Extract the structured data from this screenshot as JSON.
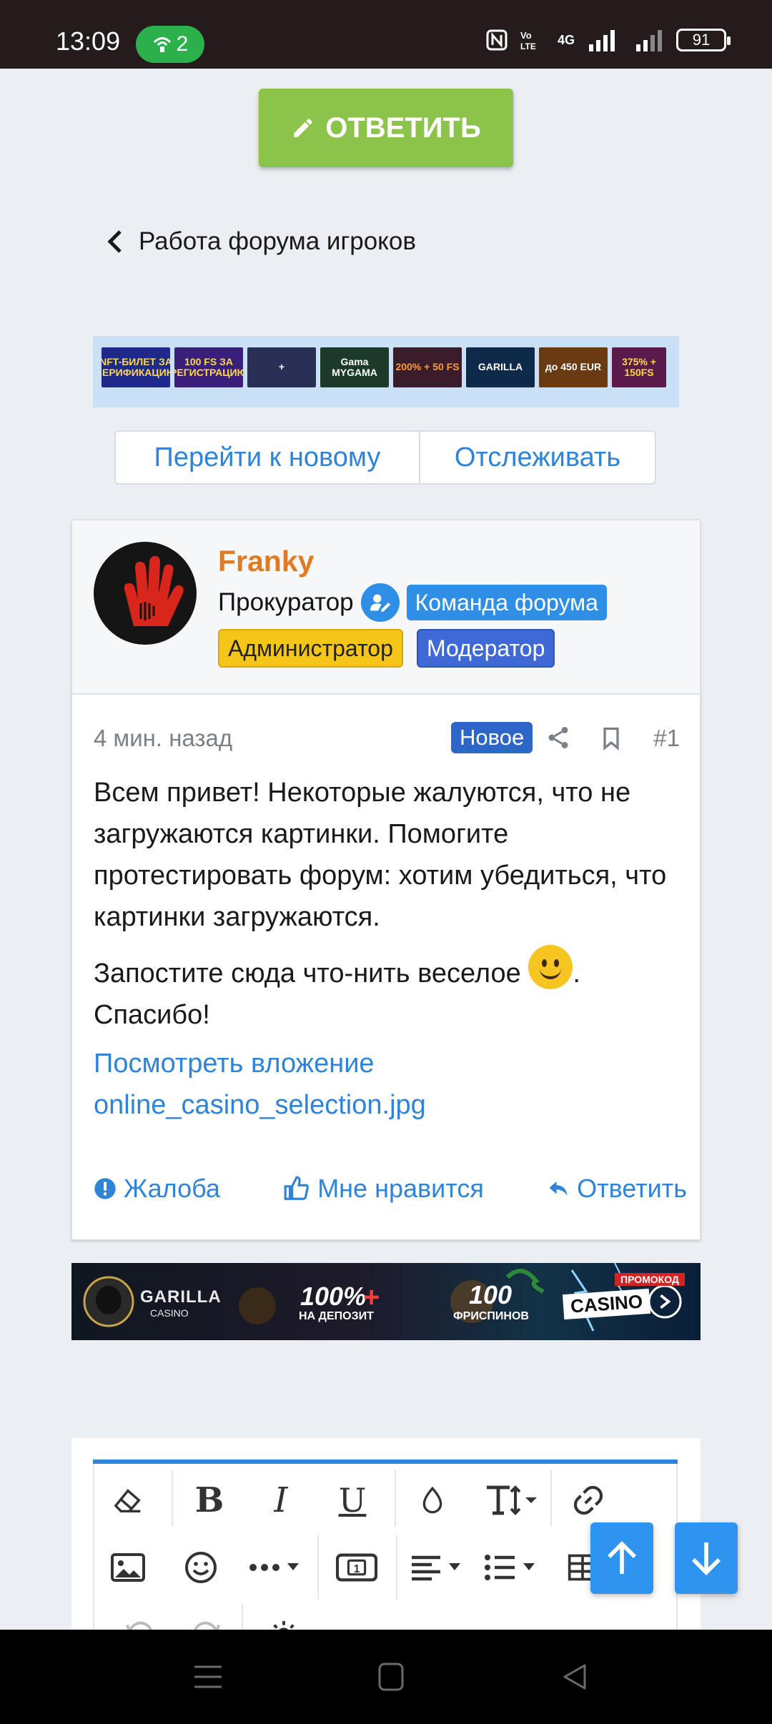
{
  "status_bar": {
    "time": "13:09",
    "hotspot_count": "2",
    "network": "4G",
    "battery": "91"
  },
  "reply_top_label": "ОТВЕТИТЬ",
  "breadcrumb": {
    "label": "Работа форума игроков"
  },
  "banners": [
    {
      "text": "NFT-БИЛЕТ ЗА ВЕРИФИКАЦИЮ",
      "color": "#1d2a8a"
    },
    {
      "text": "100 FS ЗА РЕГИСТРАЦИЮ",
      "color": "#3a1f7a"
    },
    {
      "text": "+",
      "color": "#2a2f55"
    },
    {
      "text": "Gama MYGAMA",
      "color": "#1c3a2a"
    },
    {
      "text": "200% + 50 FS",
      "color": "#3a1d2a"
    },
    {
      "text": "GARILLA",
      "color": "#0d2a4a"
    },
    {
      "text": "до 450 EUR",
      "color": "#6a3a12"
    },
    {
      "text": "375% + 150FS",
      "color": "#5a1a4a"
    }
  ],
  "thread_buttons": {
    "goto_new": "Перейти к новому",
    "watch": "Отслеживать"
  },
  "post": {
    "username": "Franky",
    "user_title": "Прокуратор",
    "badges": {
      "team": "Команда форума",
      "admin": "Администратор",
      "moderator": "Модератор"
    },
    "time": "4 мин. назад",
    "new_label": "Новое",
    "number": "#1",
    "body_p1": "Всем привет! Некоторые жалуются, что не загружаются картинки. Помогите протестировать форум: хотим убедиться, что картинки загружаются.",
    "body_p2_a": "Запостите сюда что-нить веселое",
    "body_p2_b": ". Спасибо!",
    "attachment_label": "Посмотреть вложение",
    "attachment_file": "online_casino_selection.jpg",
    "actions": {
      "report": "Жалоба",
      "like": "Мне нравится",
      "reply": "Ответить"
    }
  },
  "casino_banner": {
    "brand": "GARILLA",
    "brand_sub": "CASINO",
    "offer1": "100%",
    "offer1_sub": "НА ДЕПОЗИТ",
    "offer2": "100",
    "offer2_sub": "ФРИСПИНОВ",
    "promo_label": "ПРОМОКОД",
    "promo_code": "CASINO"
  },
  "editor": {
    "toolbar_row1": [
      "eraser-icon",
      "bold-icon",
      "italic-icon",
      "underline-icon",
      "color-icon",
      "text-size-icon",
      "link-icon"
    ],
    "toolbar_row2": [
      "image-icon",
      "emoji-icon",
      "more-icon",
      "media-icon",
      "align-icon",
      "list-icon",
      "table-icon"
    ]
  },
  "colors": {
    "accent": "#2f84d8",
    "reply_green": "#8cc34a",
    "username": "#e07b24"
  }
}
